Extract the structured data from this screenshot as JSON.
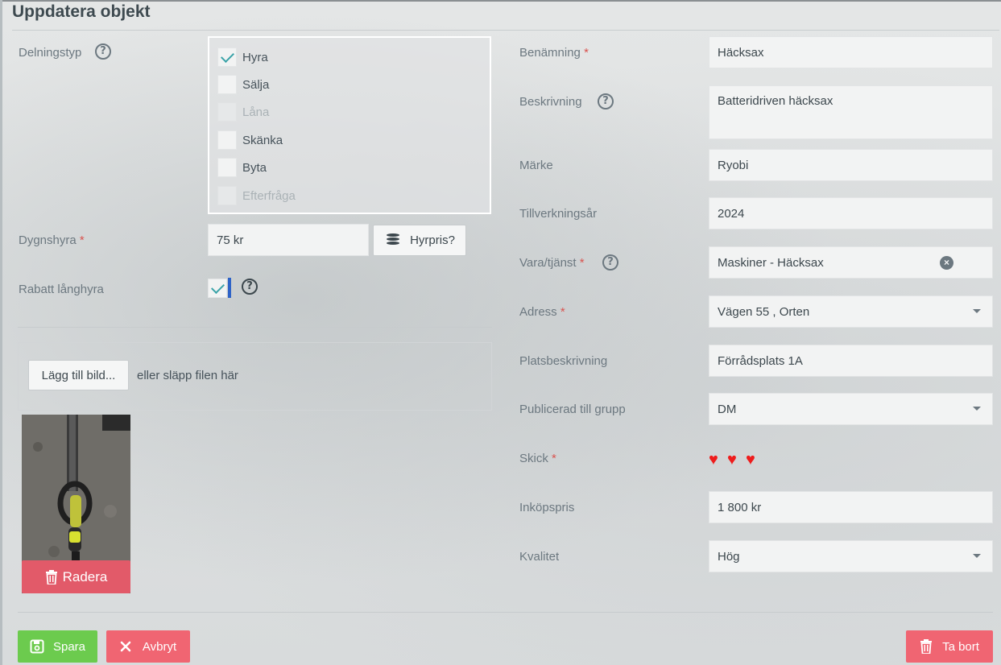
{
  "page": {
    "title": "Uppdatera objekt"
  },
  "left": {
    "delningstyp_label": "Delningstyp",
    "share_types": [
      {
        "label": "Hyra",
        "checked": true,
        "disabled": false
      },
      {
        "label": "Sälja",
        "checked": false,
        "disabled": false
      },
      {
        "label": "Låna",
        "checked": false,
        "disabled": true
      },
      {
        "label": "Skänka",
        "checked": false,
        "disabled": false
      },
      {
        "label": "Byta",
        "checked": false,
        "disabled": false
      },
      {
        "label": "Efterfråga",
        "checked": false,
        "disabled": true
      }
    ],
    "dygnshyra_label": "Dygnshyra",
    "dygnshyra_value": "75 kr",
    "hyrpris_button": "Hyrpris?",
    "rabatt_label": "Rabatt långhyra",
    "rabatt_checked": true,
    "add_image_button": "Lägg till bild...",
    "drop_text": "eller släpp filen här",
    "delete_image_button": "Radera"
  },
  "right": {
    "benamning_label": "Benämning",
    "benamning_value": "Häcksax",
    "beskrivning_label": "Beskrivning",
    "beskrivning_value": "Batteridriven häcksax",
    "marke_label": "Märke",
    "marke_value": "Ryobi",
    "tillverkningsar_label": "Tillverkningsår",
    "tillverkningsar_value": "2024",
    "vara_label": "Vara/tjänst",
    "vara_value": "Maskiner - Häcksax",
    "adress_label": "Adress",
    "adress_value": "Vägen 55 , Orten",
    "platsbeskrivning_label": "Platsbeskrivning",
    "platsbeskrivning_value": "Förrådsplats 1A",
    "publicerad_label": "Publicerad till grupp",
    "publicerad_value": "DM",
    "skick_label": "Skick",
    "skick_rating": 3,
    "inkopspris_label": "Inköpspris",
    "inkopspris_value": "1 800 kr",
    "kvalitet_label": "Kvalitet",
    "kvalitet_value": "Hög"
  },
  "footer": {
    "save_button": "Spara",
    "cancel_button": "Avbryt",
    "remove_button": "Ta bort"
  },
  "colors": {
    "save": "#6ccb4e",
    "cancel": "#f06572",
    "remove": "#f06572",
    "required": "#d9534f",
    "heart": "#ee1c1c",
    "check": "#3aa3a8"
  },
  "required_mark": "*",
  "help_glyph": "?"
}
